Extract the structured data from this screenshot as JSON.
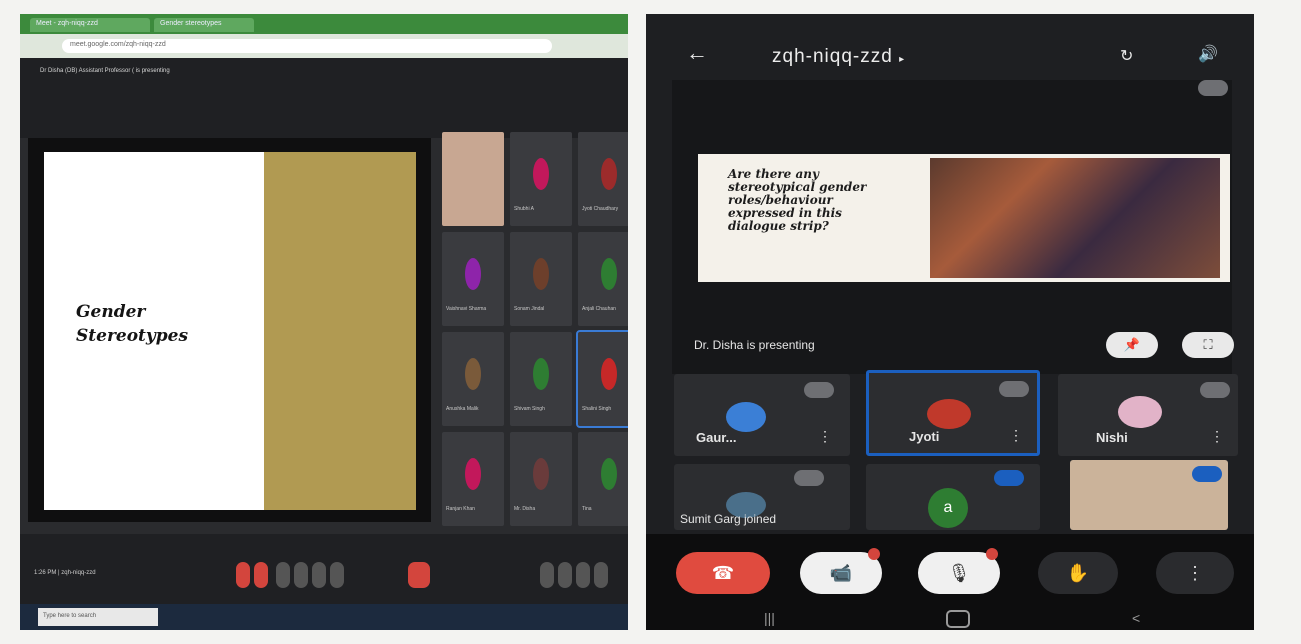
{
  "desktop": {
    "browser_tabs": [
      "Meet - zqh-niqq-zzd",
      "Gender stereotypes"
    ],
    "address": "meet.google.com/zqh-niqq-zzd",
    "meeting_title": "Dr Disha (DB) Assistant Professor ( is presenting",
    "slide_title_line1": "Gender",
    "slide_title_line2": "Stereotypes",
    "participants": [
      {
        "name": "",
        "color": "#d9b9a8"
      },
      {
        "name": "Shubhi A",
        "color": "#c2185b"
      },
      {
        "name": "Jyoti Chaudhary",
        "color": "#9c2b2b"
      },
      {
        "name": "Vaishnavi Sharma",
        "color": "#8e24aa"
      },
      {
        "name": "Sonam Jindal",
        "color": "#6d3f2b"
      },
      {
        "name": "Anjali Chauhan",
        "color": "#2e7d32"
      },
      {
        "name": "Anushka Malik",
        "color": "#7a5a3a"
      },
      {
        "name": "Shivam Singh",
        "color": "#2e7d32"
      },
      {
        "name": "Shalini Singh",
        "color": "#c62828"
      },
      {
        "name": "Ranjan Khan",
        "color": "#c2185b"
      },
      {
        "name": "Mr. Disha",
        "color": "#6a3b3b"
      },
      {
        "name": "Tina",
        "color": "#2e7d32"
      }
    ],
    "time_meta": "1:26 PM | zqh-niqq-zzd",
    "taskbar_search": "Type here to search"
  },
  "mobile": {
    "meeting_code": "zqh-niqq-zzd",
    "slide_question": "Are there any stereotypical gender roles/behaviour expressed in this dialogue strip?",
    "presenting_text": "Dr. Disha is presenting",
    "participants": [
      {
        "name": "Gaur...",
        "color": "#3b7fd6"
      },
      {
        "name": "Jyoti",
        "color": "#c0392b"
      },
      {
        "name": "Nishi",
        "color": "#e2b3c8"
      }
    ],
    "second_row_avatar_letter": "a",
    "joined_text": "Sumit Garg joined"
  }
}
